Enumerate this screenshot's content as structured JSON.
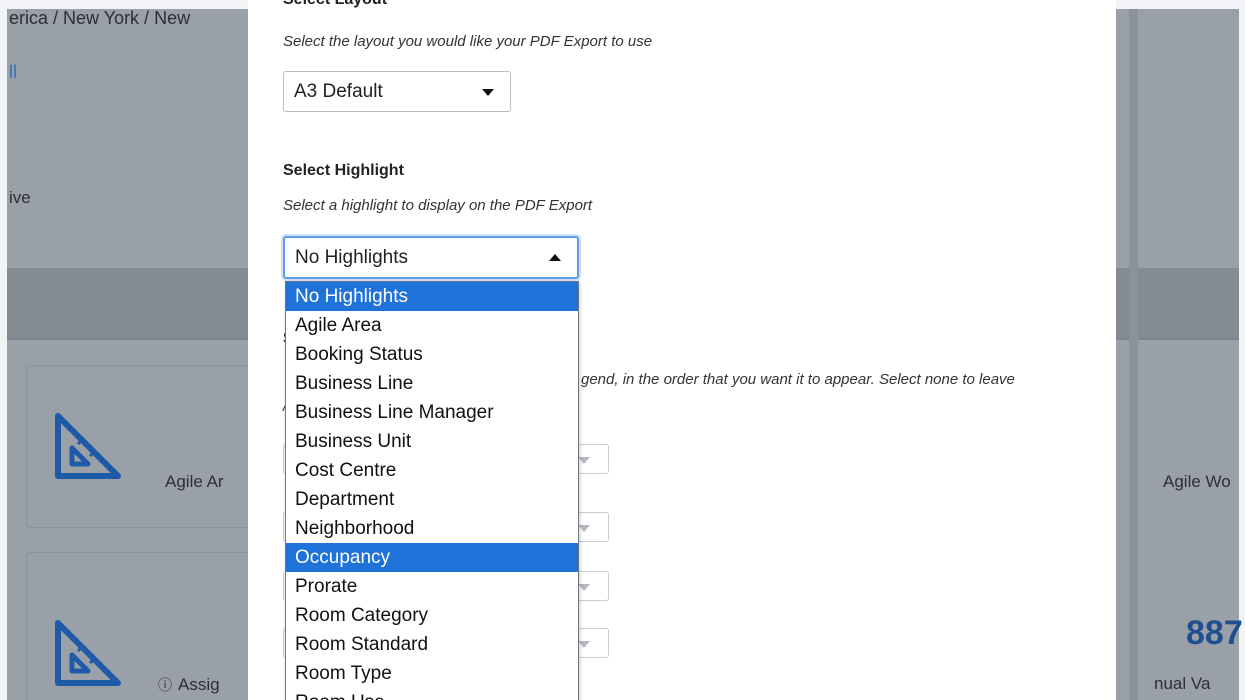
{
  "background": {
    "breadcrumb": "erica / New York / New",
    "all_link": "ll",
    "status_fragment": "ive",
    "cards": {
      "agile_area_label": "Agile Ar",
      "assign_label": "Assig",
      "assign_info_glyph": "ⓘ",
      "agile_wo_label": "Agile Wo",
      "metric_value": "887",
      "annual_label": "nual Va"
    }
  },
  "modal": {
    "layout": {
      "title": "Select Layout",
      "description": "Select the layout you would like your PDF Export to use",
      "selected": "A3 Default"
    },
    "highlight": {
      "title": "Select Highlight",
      "description": "Select a highlight to display on the PDF Export",
      "selected": "No Highlights",
      "options": [
        "No Highlights",
        "Agile Area",
        "Booking Status",
        "Business Line",
        "Business Line Manager",
        "Business Unit",
        "Cost Centre",
        "Department",
        "Neighborhood",
        "Occupancy",
        "Prorate",
        "Room Category",
        "Room Standard",
        "Room Type",
        "Room Use"
      ],
      "hovered_option": "Occupancy"
    },
    "legend": {
      "title": "S",
      "description": "gend, in the order that you want it to appear. Select none to leave",
      "description_line2": "/"
    }
  },
  "colors": {
    "accent": "#1e72d8",
    "focus_ring": "#5b9ee6",
    "metric": "#1f4f8e"
  }
}
